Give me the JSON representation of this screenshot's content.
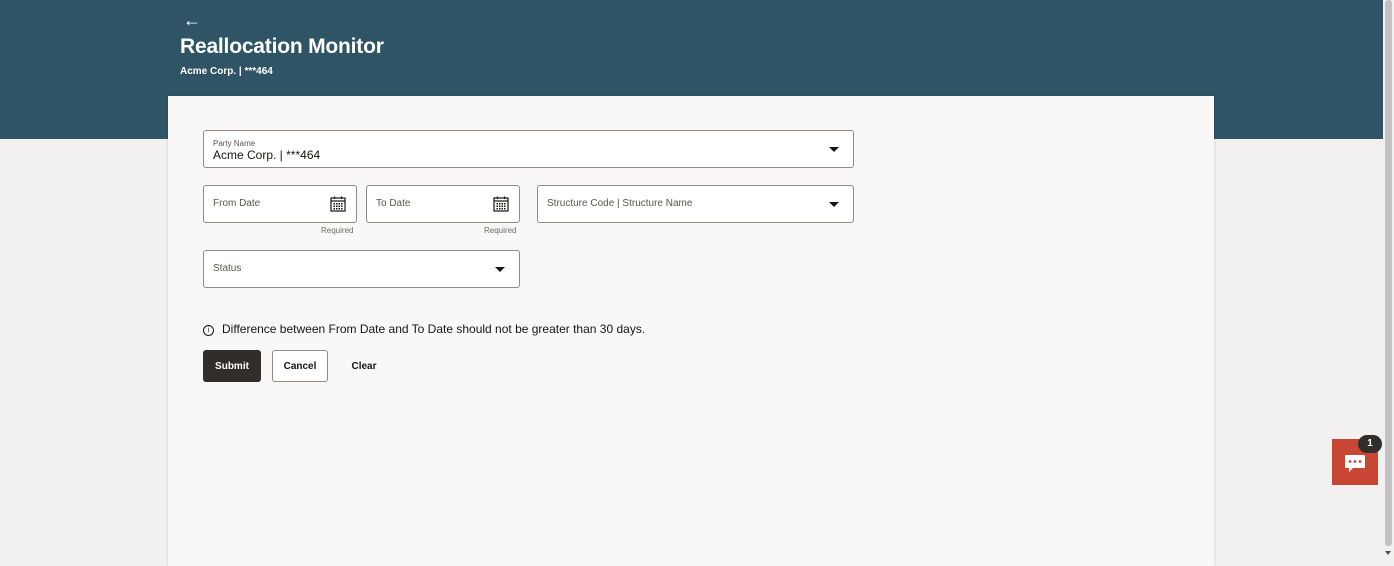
{
  "header": {
    "back_icon": "arrow-left-icon",
    "title": "Reallocation Monitor",
    "subtitle": "Acme Corp. | ***464",
    "background": "#2f5466"
  },
  "form": {
    "party_name": {
      "label": "Party Name",
      "value": "Acme Corp. | ***464"
    },
    "from_date": {
      "placeholder": "From Date",
      "hint": "Required",
      "icon": "calendar-icon"
    },
    "to_date": {
      "placeholder": "To Date",
      "hint": "Required",
      "icon": "calendar-icon"
    },
    "structure": {
      "placeholder": "Structure Code | Structure Name"
    },
    "status": {
      "placeholder": "Status"
    },
    "info_icon": "info-icon",
    "info_text": "Difference between From Date and To Date should not be greater than 30 days."
  },
  "actions": {
    "submit": "Submit",
    "cancel": "Cancel",
    "clear": "Clear"
  },
  "chat": {
    "icon": "chat-icon",
    "badge_count": "1",
    "color": "#c74634"
  }
}
